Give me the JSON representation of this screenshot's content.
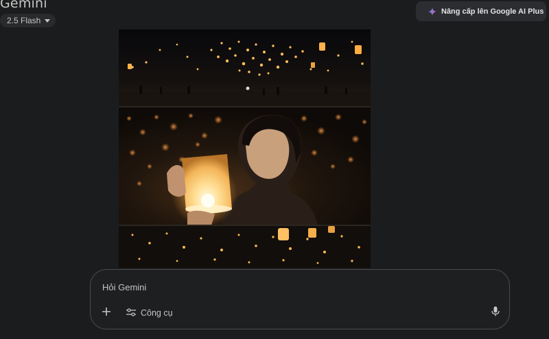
{
  "header": {
    "app_title": "Gemini",
    "model_label": "2.5 Flash",
    "upgrade_label": "Nâng cấp lên Google AI Plus"
  },
  "image": {
    "alt": "Generated image: lantern festival"
  },
  "prompt": {
    "placeholder": "Hỏi Gemini",
    "value": "",
    "tools_label": "Công cụ"
  },
  "icons": {
    "spark": "gemini-spark-icon",
    "plus": "plus-icon",
    "tools": "tools-icon",
    "mic": "microphone-icon"
  },
  "colors": {
    "background": "#1b1c1d",
    "chip": "#282a2c",
    "upgrade_button": "#2b2d30",
    "prompt_border": "#4a4c50",
    "lantern_glow": "#ffd27a"
  }
}
